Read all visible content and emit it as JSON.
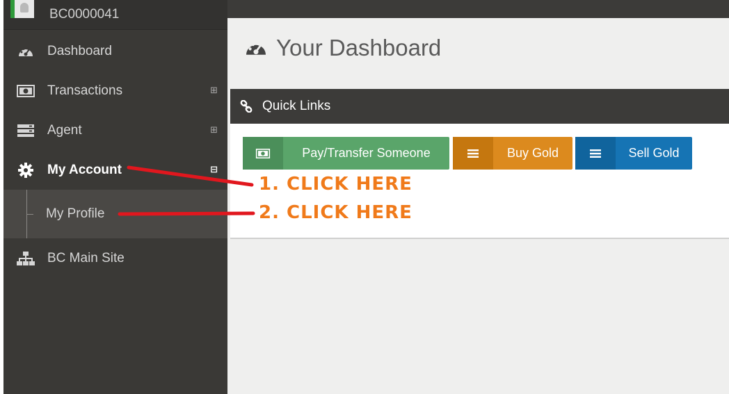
{
  "user": {
    "id": "BC0000041"
  },
  "sidebar": {
    "items": [
      {
        "label": "Dashboard",
        "icon": "dashboard-gauge-icon",
        "expand": ""
      },
      {
        "label": "Transactions",
        "icon": "money-icon",
        "expand": "⊞"
      },
      {
        "label": "Agent",
        "icon": "server-stack-icon",
        "expand": "⊞"
      },
      {
        "label": "My Account",
        "icon": "gear-icon",
        "expand": "⊟"
      },
      {
        "label": "BC Main Site",
        "icon": "sitemap-icon",
        "expand": ""
      }
    ],
    "submenu": {
      "label": "My Profile"
    }
  },
  "main": {
    "title": "Your Dashboard",
    "quick_links": {
      "title": "Quick Links",
      "buttons": [
        {
          "label": "Pay/Transfer Someone",
          "icon": "money-icon",
          "color": "#5aa56a"
        },
        {
          "label": "Buy Gold",
          "icon": "list-icon",
          "color": "#dc8a1e"
        },
        {
          "label": "Sell Gold",
          "icon": "list-icon",
          "color": "#1674b4"
        }
      ]
    }
  },
  "annotations": {
    "step1": "1. CLICK HERE",
    "step2": "2. CLICK HERE",
    "color": "#f07a1a",
    "arrow_color": "#e1171e"
  }
}
